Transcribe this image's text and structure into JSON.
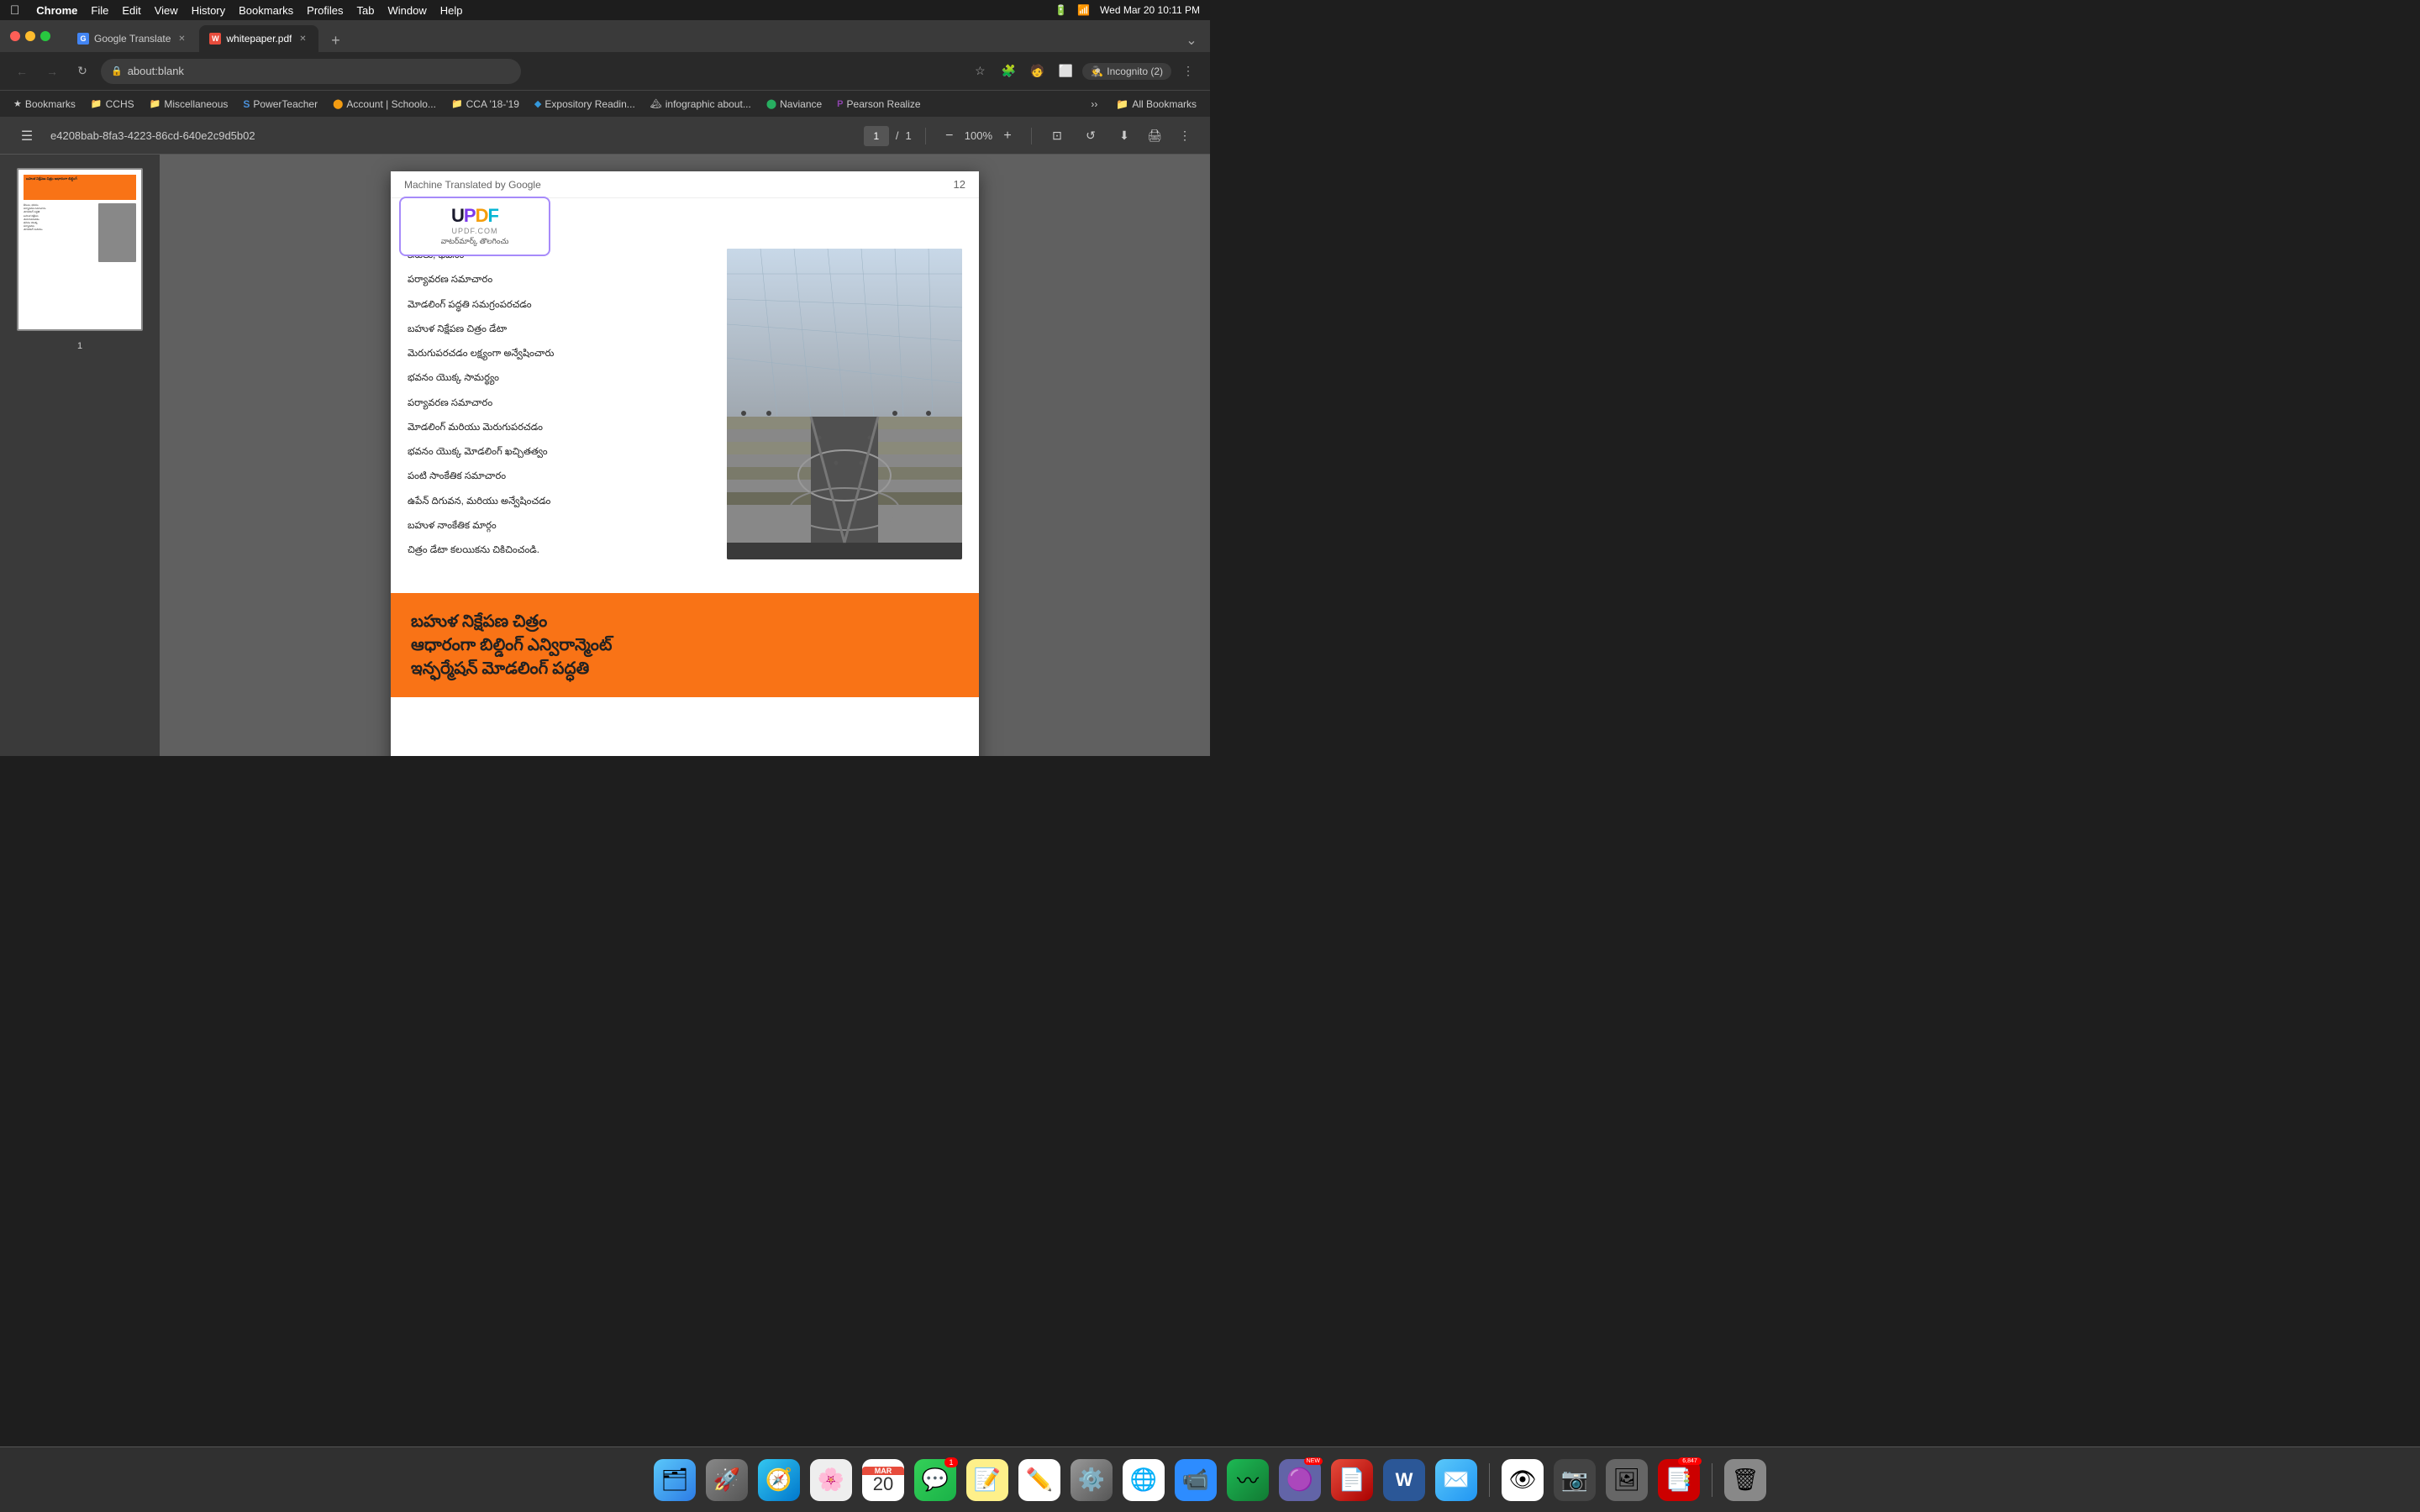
{
  "menubar": {
    "apple": "&#63743;",
    "items": [
      "Chrome",
      "File",
      "Edit",
      "View",
      "History",
      "Bookmarks",
      "Profiles",
      "Tab",
      "Window",
      "Help"
    ],
    "right": {
      "time": "Wed Mar 20  10:11 PM",
      "battery": "🔋",
      "wifi": "WiFi"
    }
  },
  "tabs": [
    {
      "id": "tab-translate",
      "favicon_color": "#4285f4",
      "favicon_letter": "G",
      "title": "Google Translate",
      "active": false,
      "has_close": true
    },
    {
      "id": "tab-whitepaper",
      "favicon_color": "#e74c3c",
      "favicon_letter": "W",
      "title": "whitepaper.pdf",
      "active": true,
      "has_close": true
    }
  ],
  "address_bar": {
    "url": "about:blank",
    "lock_icon": "🔒"
  },
  "bookmarks": [
    {
      "label": "Bookmarks",
      "icon": "★"
    },
    {
      "label": "CCHS",
      "icon": "📁"
    },
    {
      "label": "Miscellaneous",
      "icon": "📁"
    },
    {
      "label": "PowerTeacher",
      "icon": "🅂"
    },
    {
      "label": "Account | Schoolo...",
      "icon": "🔵"
    },
    {
      "label": "CCA '18-'19",
      "icon": "📁"
    },
    {
      "label": "Expository Readin...",
      "icon": "🔷"
    },
    {
      "label": "infographic about...",
      "icon": "🏔"
    },
    {
      "label": "Naviance",
      "icon": "🔵"
    },
    {
      "label": "Pearson Realize",
      "icon": "🅿"
    }
  ],
  "pdf_toolbar": {
    "title": "e4208bab-8fa3-4223-86cd-640e2c9d5b02",
    "page_current": "1",
    "page_total": "1",
    "zoom": "100%"
  },
  "pdf_content": {
    "translate_banner": "Machine Translated by Google",
    "page_number": "12",
    "updf": {
      "logo": "UPDF",
      "domain": "UPDF.COM",
      "subtitle": "వాటర్‌మార్క్ తొలగించు"
    },
    "items": [
      "కేసులు, భవనం",
      "పర్యావరణ సమాచారం",
      "మోడలింగ్ పద్ధతి సమగ్రంపరచడం",
      "బహుళ నిక్షేపణ చిత్రం డేటా",
      "మెరుగుపరచడం లక్ష్యంగా అన్వేషించారు",
      "భవనం యొక్క సామర్థ్యం",
      "పర్యావరణ సమాచారం",
      "మోడలింగ్ మరియు మెరుగుపరచడం",
      "భవనం యొక్క మోడలింగ్ ఖచ్చితత్వం",
      "పంటి సాంకేతిక సమాచారం",
      "ఉపేన్ దిగువన, మరియు అన్వేషించడం",
      "బహుళ నాంకేతిక మార్గం",
      "చిత్రం డేటా కలయికను చికిచించండి."
    ],
    "orange_banner": {
      "line1": "బహుళ నిక్షేపణ చిత్రం",
      "line2": "ఆధారంగా బిల్డింగ్ ఎన్విరాన్మెంట్",
      "line3": "ఇన్ఫర్మేషన్ మోడలింగ్ పద్ధతి"
    }
  },
  "thumbnail": {
    "label": "1"
  },
  "dock_items": [
    {
      "id": "finder",
      "emoji": "😊",
      "color": "#2196F3",
      "badge": "",
      "label": "Finder"
    },
    {
      "id": "launchpad",
      "emoji": "🚀",
      "color": "#888",
      "badge": "",
      "label": "Launchpad"
    },
    {
      "id": "safari",
      "emoji": "🧭",
      "color": "#0ea5e9",
      "badge": "",
      "label": "Safari"
    },
    {
      "id": "photos",
      "emoji": "📸",
      "color": "#eee",
      "badge": "",
      "label": "Photos"
    },
    {
      "id": "calendar",
      "emoji": "20",
      "color": "#fff",
      "badge": "",
      "label": "Calendar",
      "is_calendar": true
    },
    {
      "id": "messages",
      "emoji": "💬",
      "color": "#34d058",
      "badge": "1",
      "label": "Messages"
    },
    {
      "id": "notes",
      "emoji": "📝",
      "color": "#fef08a",
      "badge": "",
      "label": "Notes"
    },
    {
      "id": "freeform",
      "emoji": "✏️",
      "color": "#fff",
      "badge": "",
      "label": "Freeform"
    },
    {
      "id": "systemprefs",
      "emoji": "⚙️",
      "color": "#888",
      "badge": "",
      "label": "System Preferences"
    },
    {
      "id": "chrome",
      "emoji": "🌐",
      "color": "#4285f4",
      "badge": "",
      "label": "Chrome"
    },
    {
      "id": "zoom",
      "emoji": "📹",
      "color": "#2d8cff",
      "badge": "",
      "label": "Zoom"
    },
    {
      "id": "waveform",
      "emoji": "〰",
      "color": "#1db954",
      "badge": "",
      "label": "Waveform"
    },
    {
      "id": "teams",
      "emoji": "🟣",
      "color": "#6264a7",
      "badge": "NEW",
      "label": "Teams"
    },
    {
      "id": "acrobat",
      "emoji": "📄",
      "color": "#e74c3c",
      "badge": "",
      "label": "Acrobat"
    },
    {
      "id": "word",
      "emoji": "W",
      "color": "#2b5797",
      "badge": "",
      "label": "Word"
    },
    {
      "id": "mail",
      "emoji": "✉️",
      "color": "#2196F3",
      "badge": "",
      "label": "Mail"
    },
    {
      "id": "preview",
      "emoji": "👁",
      "color": "#fff",
      "badge": "",
      "label": "Preview"
    },
    {
      "id": "screenshots",
      "emoji": "📷",
      "color": "#555",
      "badge": "",
      "label": "Screenshots"
    },
    {
      "id": "imgprev",
      "emoji": "🖼",
      "color": "#999",
      "badge": "",
      "label": "Image Preview"
    },
    {
      "id": "pdf2",
      "emoji": "📑",
      "color": "#c00",
      "badge": "",
      "label": "PDF"
    },
    {
      "id": "trash",
      "emoji": "🗑",
      "color": "#888",
      "badge": "",
      "label": "Trash"
    }
  ],
  "incognito": {
    "label": "Incognito (2)",
    "icon": "🕵"
  }
}
